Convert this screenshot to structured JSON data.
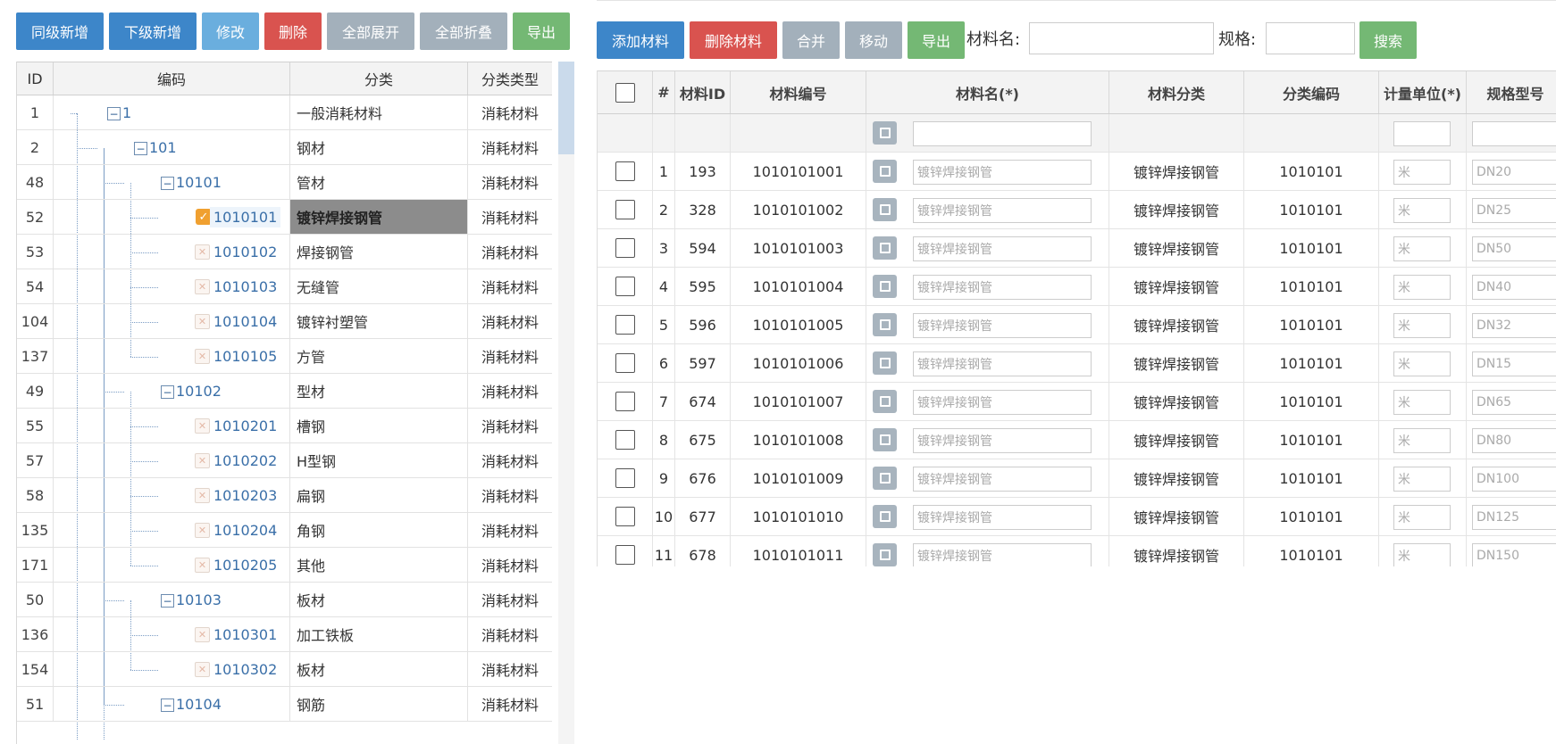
{
  "left_toolbar": [
    {
      "label": "同级新增",
      "color": "blue"
    },
    {
      "label": "下级新增",
      "color": "blue"
    },
    {
      "label": "修改",
      "color": "lblue"
    },
    {
      "label": "删除",
      "color": "red"
    },
    {
      "label": "全部展开",
      "color": "gray"
    },
    {
      "label": "全部折叠",
      "color": "gray"
    },
    {
      "label": "导出",
      "color": "green"
    }
  ],
  "right_toolbar": [
    {
      "label": "添加材料",
      "color": "blue"
    },
    {
      "label": "删除材料",
      "color": "red"
    },
    {
      "label": "合并",
      "color": "gray"
    },
    {
      "label": "移动",
      "color": "gray"
    },
    {
      "label": "导出",
      "color": "green"
    }
  ],
  "search": {
    "name_label": "材料名:",
    "spec_label": "规格:",
    "name_value": "",
    "spec_value": "",
    "search_button": "搜索"
  },
  "tree": {
    "headers": [
      "ID",
      "编码",
      "分类",
      "分类类型"
    ],
    "rows": [
      {
        "id": "1",
        "code": "1",
        "category": "一般消耗材料",
        "type": "消耗材料",
        "level": 0,
        "node": "folder"
      },
      {
        "id": "2",
        "code": "101",
        "category": "钢材",
        "type": "消耗材料",
        "level": 1,
        "node": "folder"
      },
      {
        "id": "48",
        "code": "10101",
        "category": "管材",
        "type": "消耗材料",
        "level": 2,
        "node": "folder"
      },
      {
        "id": "52",
        "code": "1010101",
        "category": "镀锌焊接钢管",
        "type": "消耗材料",
        "level": 3,
        "node": "checked",
        "selected": true
      },
      {
        "id": "53",
        "code": "1010102",
        "category": "焊接钢管",
        "type": "消耗材料",
        "level": 3,
        "node": "leaf"
      },
      {
        "id": "54",
        "code": "1010103",
        "category": "无缝管",
        "type": "消耗材料",
        "level": 3,
        "node": "leaf"
      },
      {
        "id": "104",
        "code": "1010104",
        "category": "镀锌衬塑管",
        "type": "消耗材料",
        "level": 3,
        "node": "leaf"
      },
      {
        "id": "137",
        "code": "1010105",
        "category": "方管",
        "type": "消耗材料",
        "level": 3,
        "node": "leaf"
      },
      {
        "id": "49",
        "code": "10102",
        "category": "型材",
        "type": "消耗材料",
        "level": 2,
        "node": "folder"
      },
      {
        "id": "55",
        "code": "1010201",
        "category": "槽钢",
        "type": "消耗材料",
        "level": 3,
        "node": "leaf"
      },
      {
        "id": "57",
        "code": "1010202",
        "category": "H型钢",
        "type": "消耗材料",
        "level": 3,
        "node": "leaf"
      },
      {
        "id": "58",
        "code": "1010203",
        "category": "扁钢",
        "type": "消耗材料",
        "level": 3,
        "node": "leaf"
      },
      {
        "id": "135",
        "code": "1010204",
        "category": "角钢",
        "type": "消耗材料",
        "level": 3,
        "node": "leaf"
      },
      {
        "id": "171",
        "code": "1010205",
        "category": "其他",
        "type": "消耗材料",
        "level": 3,
        "node": "leaf"
      },
      {
        "id": "50",
        "code": "10103",
        "category": "板材",
        "type": "消耗材料",
        "level": 2,
        "node": "folder"
      },
      {
        "id": "136",
        "code": "1010301",
        "category": "加工铁板",
        "type": "消耗材料",
        "level": 3,
        "node": "leaf"
      },
      {
        "id": "154",
        "code": "1010302",
        "category": "板材",
        "type": "消耗材料",
        "level": 3,
        "node": "leaf"
      },
      {
        "id": "51",
        "code": "10104",
        "category": "钢筋",
        "type": "消耗材料",
        "level": 2,
        "node": "folder"
      }
    ]
  },
  "materials": {
    "headers": [
      "#",
      "材料ID",
      "材料编号",
      "材料名(*)",
      "材料分类",
      "分类编码",
      "计量单位(*)",
      "规格型号"
    ],
    "filter": {
      "name": "",
      "unit": "",
      "spec": ""
    },
    "rows": [
      {
        "n": "1",
        "id": "193",
        "code": "1010101001",
        "name": "镀锌焊接钢管",
        "cat": "镀锌焊接钢管",
        "cat_code": "1010101",
        "unit": "米",
        "spec": "DN20"
      },
      {
        "n": "2",
        "id": "328",
        "code": "1010101002",
        "name": "镀锌焊接钢管",
        "cat": "镀锌焊接钢管",
        "cat_code": "1010101",
        "unit": "米",
        "spec": "DN25"
      },
      {
        "n": "3",
        "id": "594",
        "code": "1010101003",
        "name": "镀锌焊接钢管",
        "cat": "镀锌焊接钢管",
        "cat_code": "1010101",
        "unit": "米",
        "spec": "DN50"
      },
      {
        "n": "4",
        "id": "595",
        "code": "1010101004",
        "name": "镀锌焊接钢管",
        "cat": "镀锌焊接钢管",
        "cat_code": "1010101",
        "unit": "米",
        "spec": "DN40"
      },
      {
        "n": "5",
        "id": "596",
        "code": "1010101005",
        "name": "镀锌焊接钢管",
        "cat": "镀锌焊接钢管",
        "cat_code": "1010101",
        "unit": "米",
        "spec": "DN32"
      },
      {
        "n": "6",
        "id": "597",
        "code": "1010101006",
        "name": "镀锌焊接钢管",
        "cat": "镀锌焊接钢管",
        "cat_code": "1010101",
        "unit": "米",
        "spec": "DN15"
      },
      {
        "n": "7",
        "id": "674",
        "code": "1010101007",
        "name": "镀锌焊接钢管",
        "cat": "镀锌焊接钢管",
        "cat_code": "1010101",
        "unit": "米",
        "spec": "DN65"
      },
      {
        "n": "8",
        "id": "675",
        "code": "1010101008",
        "name": "镀锌焊接钢管",
        "cat": "镀锌焊接钢管",
        "cat_code": "1010101",
        "unit": "米",
        "spec": "DN80"
      },
      {
        "n": "9",
        "id": "676",
        "code": "1010101009",
        "name": "镀锌焊接钢管",
        "cat": "镀锌焊接钢管",
        "cat_code": "1010101",
        "unit": "米",
        "spec": "DN100"
      },
      {
        "n": "10",
        "id": "677",
        "code": "1010101010",
        "name": "镀锌焊接钢管",
        "cat": "镀锌焊接钢管",
        "cat_code": "1010101",
        "unit": "米",
        "spec": "DN125"
      },
      {
        "n": "11",
        "id": "678",
        "code": "1010101011",
        "name": "镀锌焊接钢管",
        "cat": "镀锌焊接钢管",
        "cat_code": "1010101",
        "unit": "米",
        "spec": "DN150"
      }
    ]
  }
}
